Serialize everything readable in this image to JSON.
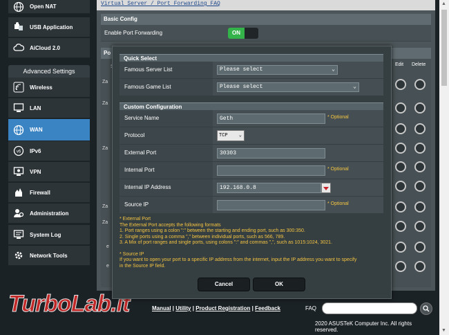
{
  "breadcrumb_link": "Virtual Server / Port Forwarding FAQ",
  "sidebar": {
    "top_items": [
      {
        "label": "Open NAT",
        "icon": "globe-icon"
      },
      {
        "label": "USB Application",
        "icon": "puzzle-icon"
      },
      {
        "label": "AiCloud 2.0",
        "icon": "cloud-icon"
      }
    ],
    "advanced_header": "Advanced Settings",
    "items": [
      {
        "label": "Wireless",
        "icon": "wifi-icon"
      },
      {
        "label": "LAN",
        "icon": "monitor-icon"
      },
      {
        "label": "WAN",
        "icon": "globe-icon"
      },
      {
        "label": "IPv6",
        "icon": "ipv6-icon"
      },
      {
        "label": "VPN",
        "icon": "vpn-icon"
      },
      {
        "label": "Firewall",
        "icon": "firewall-icon"
      },
      {
        "label": "Administration",
        "icon": "admin-icon"
      },
      {
        "label": "System Log",
        "icon": "log-icon"
      },
      {
        "label": "Network Tools",
        "icon": "tools-icon"
      }
    ],
    "active_index": 2
  },
  "main": {
    "basic_config_title": "Basic Config",
    "enable_label": "Enable Port Forwarding",
    "enable_value": "ON",
    "list_head_partial": "Po",
    "list_col_s": "S",
    "edit_col": "Edit",
    "delete_col": "Delete",
    "row_fragments": [
      "Za",
      "Za",
      "Za",
      "Za",
      "Za",
      "e",
      "e"
    ]
  },
  "modal": {
    "quick_select_title": "Quick Select",
    "famous_server_label": "Famous Server List",
    "famous_server_value": "Please select",
    "famous_game_label": "Famous Game List",
    "famous_game_value": "Please select",
    "custom_title": "Custom Configuration",
    "service_name_label": "Service Name",
    "service_name_value": "Geth",
    "optional": "* Optional",
    "protocol_label": "Protocol",
    "protocol_value": "TCP",
    "external_port_label": "External Port",
    "external_port_value": "30303",
    "internal_port_label": "Internal Port",
    "internal_port_value": "",
    "internal_ip_label": "Internal IP Address",
    "internal_ip_value": "192.168.0.8",
    "source_ip_label": "Source IP",
    "source_ip_value": "",
    "notes": {
      "ext_title": "* External Port",
      "ext_line1": "The External Port accepts the following formats",
      "ext_line2": "1. Port ranges using a colon \":\" between the starting and ending port, such as 300:350.",
      "ext_line3": "2. Single ports using a comma \",\" between individual ports, such as 566, 789.",
      "ext_line4": "3. A Mix of port ranges and single ports, using colons \":\" and commas \",\", such as 1015:1024, 3021.",
      "src_title": "* Source IP",
      "src_line1": "If you want to open your port to a specific IP address from the internet, input the IP address you want to specify",
      "src_line2": "in the Source IP field."
    },
    "cancel": "Cancel",
    "ok": "OK"
  },
  "footer": {
    "link_manual": "Manual",
    "link_utility": "Utility",
    "link_registration": "Product Registration",
    "link_feedback": "Feedback",
    "faq": "FAQ",
    "copyright": "2020 ASUSTeK Computer Inc. All rights reserved.",
    "sep": "|"
  },
  "watermark": "TurboLab.it",
  "colors": {
    "accent_active": "#3a84c4",
    "toggle_on": "#33b34a",
    "optional": "#f5c542",
    "watermark": "#d32a2a"
  }
}
